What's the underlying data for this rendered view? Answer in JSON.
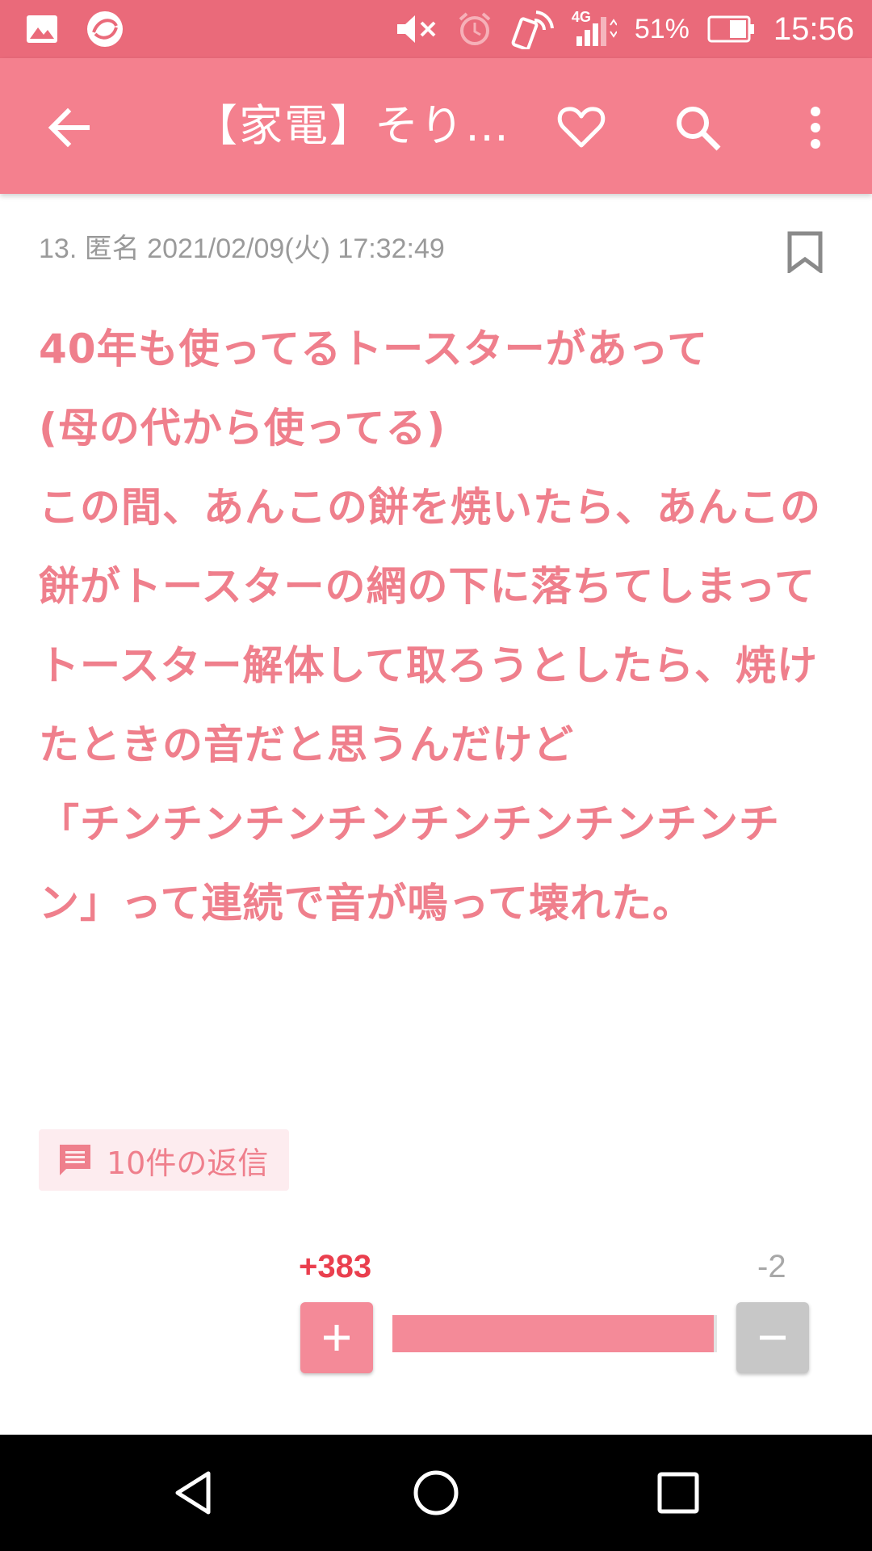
{
  "status_bar": {
    "battery": "51%",
    "time": "15:56",
    "network": "4G",
    "icons": [
      "gallery-icon",
      "app-notification-icon",
      "mute-icon",
      "alarm-icon",
      "nfc-icon",
      "signal-icon",
      "battery-icon"
    ]
  },
  "app_bar": {
    "title": "【家電】そり…",
    "icons": [
      "back-arrow-icon",
      "heart-icon",
      "search-icon",
      "more-vert-icon"
    ]
  },
  "comment": {
    "meta": "13. 匿名 2021/02/09(火) 17:32:49",
    "body": "40年も使ってるトースターがあって\n(母の代から使ってる)\nこの間、あんこの餅を焼いたら、あんこの餅がトースターの網の下に落ちてしまって\nトースター解体して取ろうとしたら、焼けたときの音だと思うんだけど\n「チンチンチンチンチンチンチンチンチン」って連続で音が鳴って壊れた。",
    "replies_label": "10件の返信",
    "plus_votes": "+383",
    "minus_votes": "-2",
    "vote_ratio": 0.99
  },
  "colors": {
    "status_bar": "#ea6a7a",
    "app_bar": "#f4808e",
    "body_text": "#ef7f8c",
    "plus": "#ea3f4e"
  },
  "nav_bar": {
    "icons": [
      "back-triangle-icon",
      "home-circle-icon",
      "recents-square-icon"
    ]
  }
}
